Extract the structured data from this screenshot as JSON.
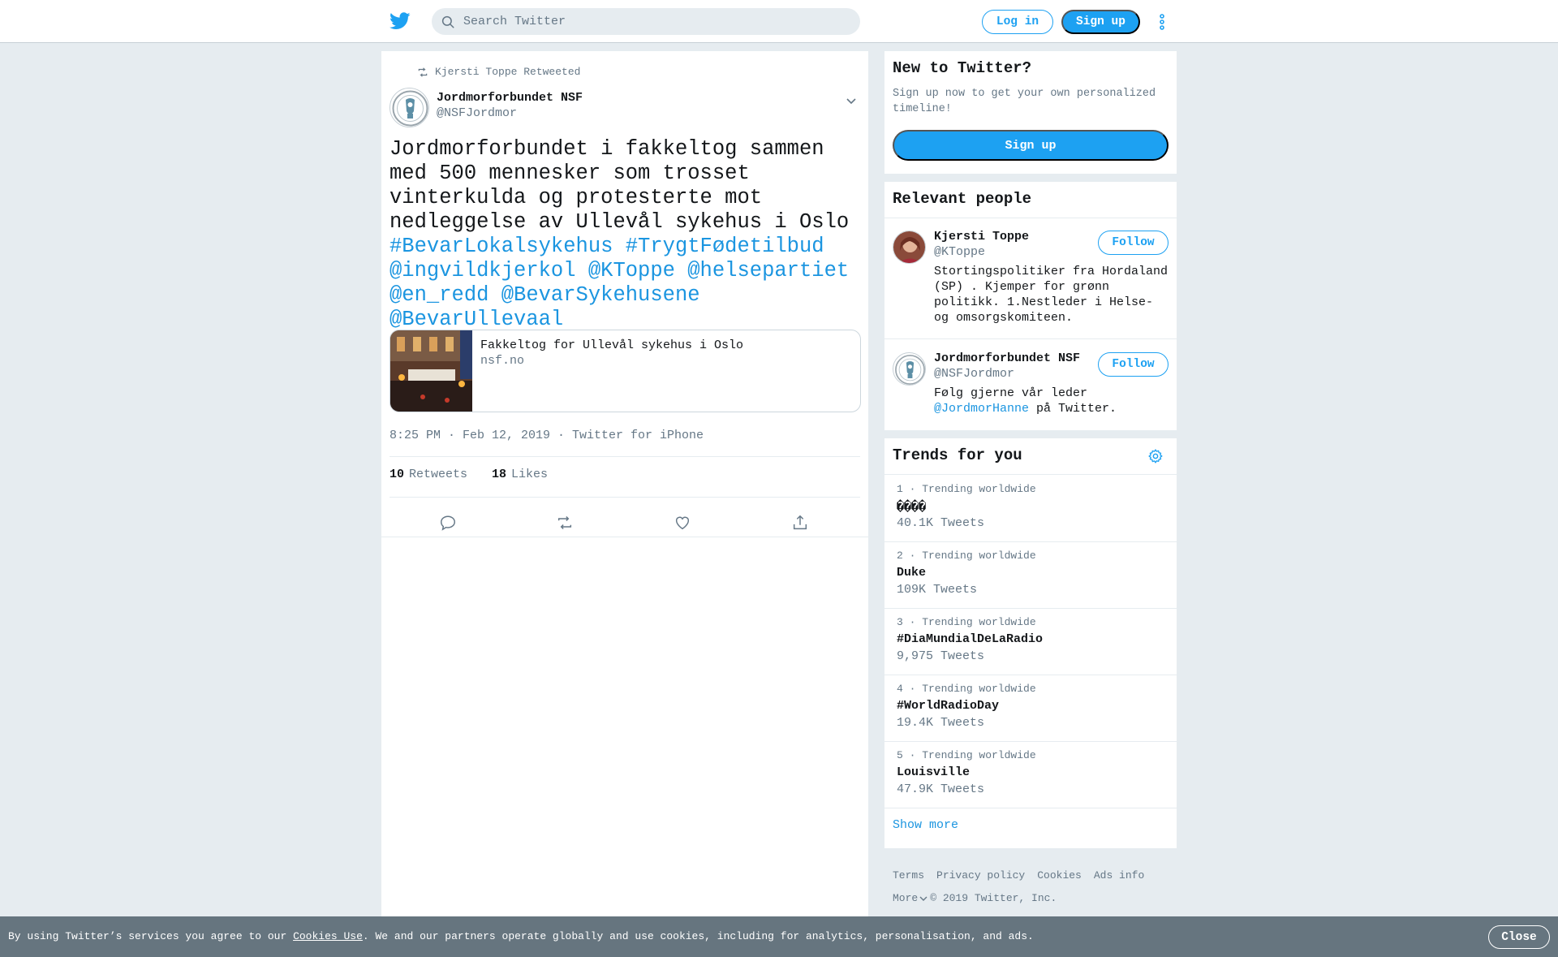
{
  "header": {
    "search_placeholder": "Search Twitter",
    "login_label": "Log in",
    "signup_label": "Sign up"
  },
  "tweet": {
    "retweeted_by": "Kjersti Toppe Retweeted",
    "author_name": "Jordmorforbundet NSF",
    "author_handle": "@NSFJordmor",
    "text_plain": "Jordmorforbundet i fakkeltog sammen med 500 mennesker som trosset vinterkulda og protesterte mot nedleggelse av Ullevål sykehus i Oslo ",
    "text_links": "#BevarLokalsykehus #TrygtFødetilbud @ingvildkjerkol @KToppe @helsepartiet @en_redd @BevarSykehusene @BevarUllevaal",
    "card_title": "Fakkeltog for Ullevål sykehus i Oslo",
    "card_domain": "nsf.no",
    "meta": "8:25 PM · Feb 12, 2019 · Twitter for iPhone",
    "retweets_count": "10",
    "retweets_label": "Retweets",
    "likes_count": "18",
    "likes_label": "Likes"
  },
  "sidebar": {
    "new_to_twitter": {
      "title": "New to Twitter?",
      "text": "Sign up now to get your own personalized timeline!",
      "button": "Sign up"
    },
    "relevant": {
      "title": "Relevant people",
      "people": [
        {
          "name": "Kjersti Toppe",
          "handle": "@KToppe",
          "bio": "Stortingspolitiker fra Hordaland (SP) . Kjemper for grønn politikk. 1.Nestleder i Helse- og omsorgskomiteen.",
          "follow": "Follow"
        },
        {
          "name": "Jordmorforbundet NSF",
          "handle": "@NSFJordmor",
          "bio_before": "Følg gjerne vår leder ",
          "bio_link": "@JordmorHanne",
          "bio_after": " på Twitter.",
          "follow": "Follow"
        }
      ]
    },
    "trends": {
      "title": "Trends for you",
      "items": [
        {
          "rank": "1 · Trending worldwide",
          "name": "����",
          "count": "40.1K Tweets"
        },
        {
          "rank": "2 · Trending worldwide",
          "name": "Duke",
          "count": "109K Tweets"
        },
        {
          "rank": "3 · Trending worldwide",
          "name": "#DiaMundialDeLaRadio",
          "count": "9,975 Tweets"
        },
        {
          "rank": "4 · Trending worldwide",
          "name": "#WorldRadioDay",
          "count": "19.4K Tweets"
        },
        {
          "rank": "5 · Trending worldwide",
          "name": "Louisville",
          "count": "47.9K Tweets"
        }
      ],
      "show_more": "Show more"
    },
    "footer": {
      "links": [
        "Terms",
        "Privacy policy",
        "Cookies",
        "Ads info"
      ],
      "more": "More",
      "copyright": "© 2019 Twitter, Inc."
    }
  },
  "cookie": {
    "before": "By using Twitter’s services you agree to our ",
    "link": "Cookies Use",
    "after": ". We and our partners operate globally and use cookies, including for analytics, personalisation, and ads.",
    "close": "Close"
  },
  "colors": {
    "brand": "#1da1f2",
    "link": "#1b95e0",
    "background": "#e6ecf0",
    "muted": "#657786"
  }
}
